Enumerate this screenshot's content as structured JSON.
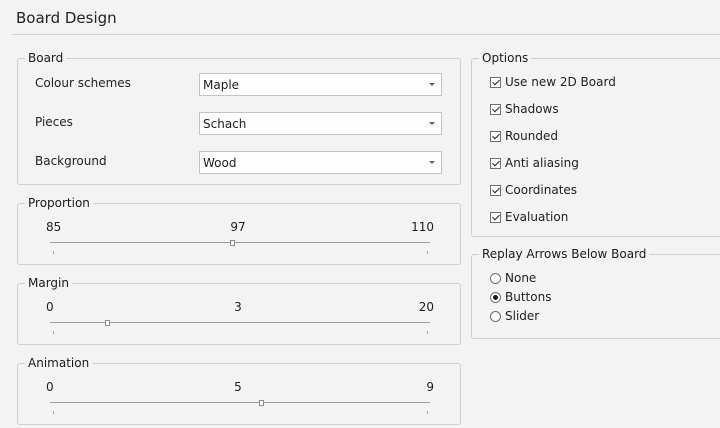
{
  "page": {
    "title": "Board Design"
  },
  "board": {
    "legend": "Board",
    "colour_schemes": {
      "label": "Colour schemes",
      "value": "Maple"
    },
    "pieces": {
      "label": "Pieces",
      "value": "Schach"
    },
    "background": {
      "label": "Background",
      "value": "Wood"
    }
  },
  "proportion": {
    "legend": "Proportion",
    "min": "85",
    "current": "97",
    "max": "110",
    "level": 0.48
  },
  "margin": {
    "legend": "Margin",
    "min": "0",
    "current": "3",
    "max": "20",
    "level": 0.15
  },
  "animation": {
    "legend": "Animation",
    "min": "0",
    "current": "5",
    "max": "9",
    "level": 0.555
  },
  "options": {
    "legend": "Options",
    "items": [
      {
        "label": "Use new 2D Board",
        "checked": true
      },
      {
        "label": "Shadows",
        "checked": true
      },
      {
        "label": "Rounded",
        "checked": true
      },
      {
        "label": "Anti aliasing",
        "checked": true
      },
      {
        "label": "Coordinates",
        "checked": true
      },
      {
        "label": "Evaluation",
        "checked": true
      }
    ]
  },
  "replay": {
    "legend": "Replay Arrows Below Board",
    "options": [
      {
        "label": "None",
        "selected": false
      },
      {
        "label": "Buttons",
        "selected": true
      },
      {
        "label": "Slider",
        "selected": false
      }
    ]
  }
}
